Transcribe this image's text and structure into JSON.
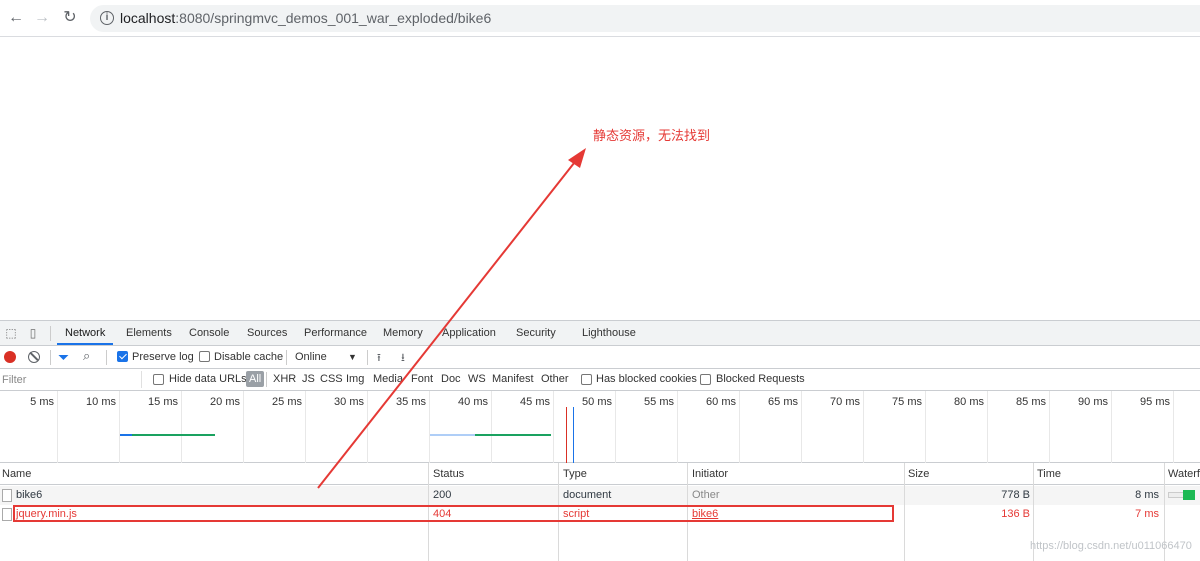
{
  "browser": {
    "url_host": "localhost",
    "url_rest": ":8080/springmvc_demos_001_war_exploded/bike6"
  },
  "annotation": {
    "text": "静态资源，无法找到",
    "color": "#e53935"
  },
  "devtools": {
    "tabs": [
      "Network",
      "Elements",
      "Console",
      "Sources",
      "Performance",
      "Memory",
      "Application",
      "Security",
      "Lighthouse"
    ],
    "active_tab": "Network",
    "toolbar": {
      "preserve_log": "Preserve log",
      "preserve_log_checked": true,
      "disable_cache": "Disable cache",
      "disable_cache_checked": false,
      "throttle": "Online",
      "throttle_arrow": "▼"
    },
    "filter": {
      "placeholder": "Filter",
      "hide_data_urls": "Hide data URLs",
      "types": [
        "All",
        "XHR",
        "JS",
        "CSS",
        "Img",
        "Media",
        "Font",
        "Doc",
        "WS",
        "Manifest",
        "Other"
      ],
      "has_blocked_cookies": "Has blocked cookies",
      "blocked_requests": "Blocked Requests"
    },
    "overview_ticks": [
      "5 ms",
      "10 ms",
      "15 ms",
      "20 ms",
      "25 ms",
      "30 ms",
      "35 ms",
      "40 ms",
      "45 ms",
      "50 ms",
      "55 ms",
      "60 ms",
      "65 ms",
      "70 ms",
      "75 ms",
      "80 ms",
      "85 ms",
      "90 ms",
      "95 ms"
    ],
    "columns": [
      "Name",
      "Status",
      "Type",
      "Initiator",
      "Size",
      "Time",
      "Waterfall"
    ],
    "rows": [
      {
        "name": "bike6",
        "status": "200",
        "type": "document",
        "initiator": "Other",
        "size": "778 B",
        "time": "8 ms",
        "error": false
      },
      {
        "name": "jquery.min.js",
        "status": "404",
        "type": "script",
        "initiator": "bike6",
        "size": "136 B",
        "time": "7 ms",
        "error": true
      }
    ]
  },
  "watermark": "https://blog.csdn.net/u011066470"
}
